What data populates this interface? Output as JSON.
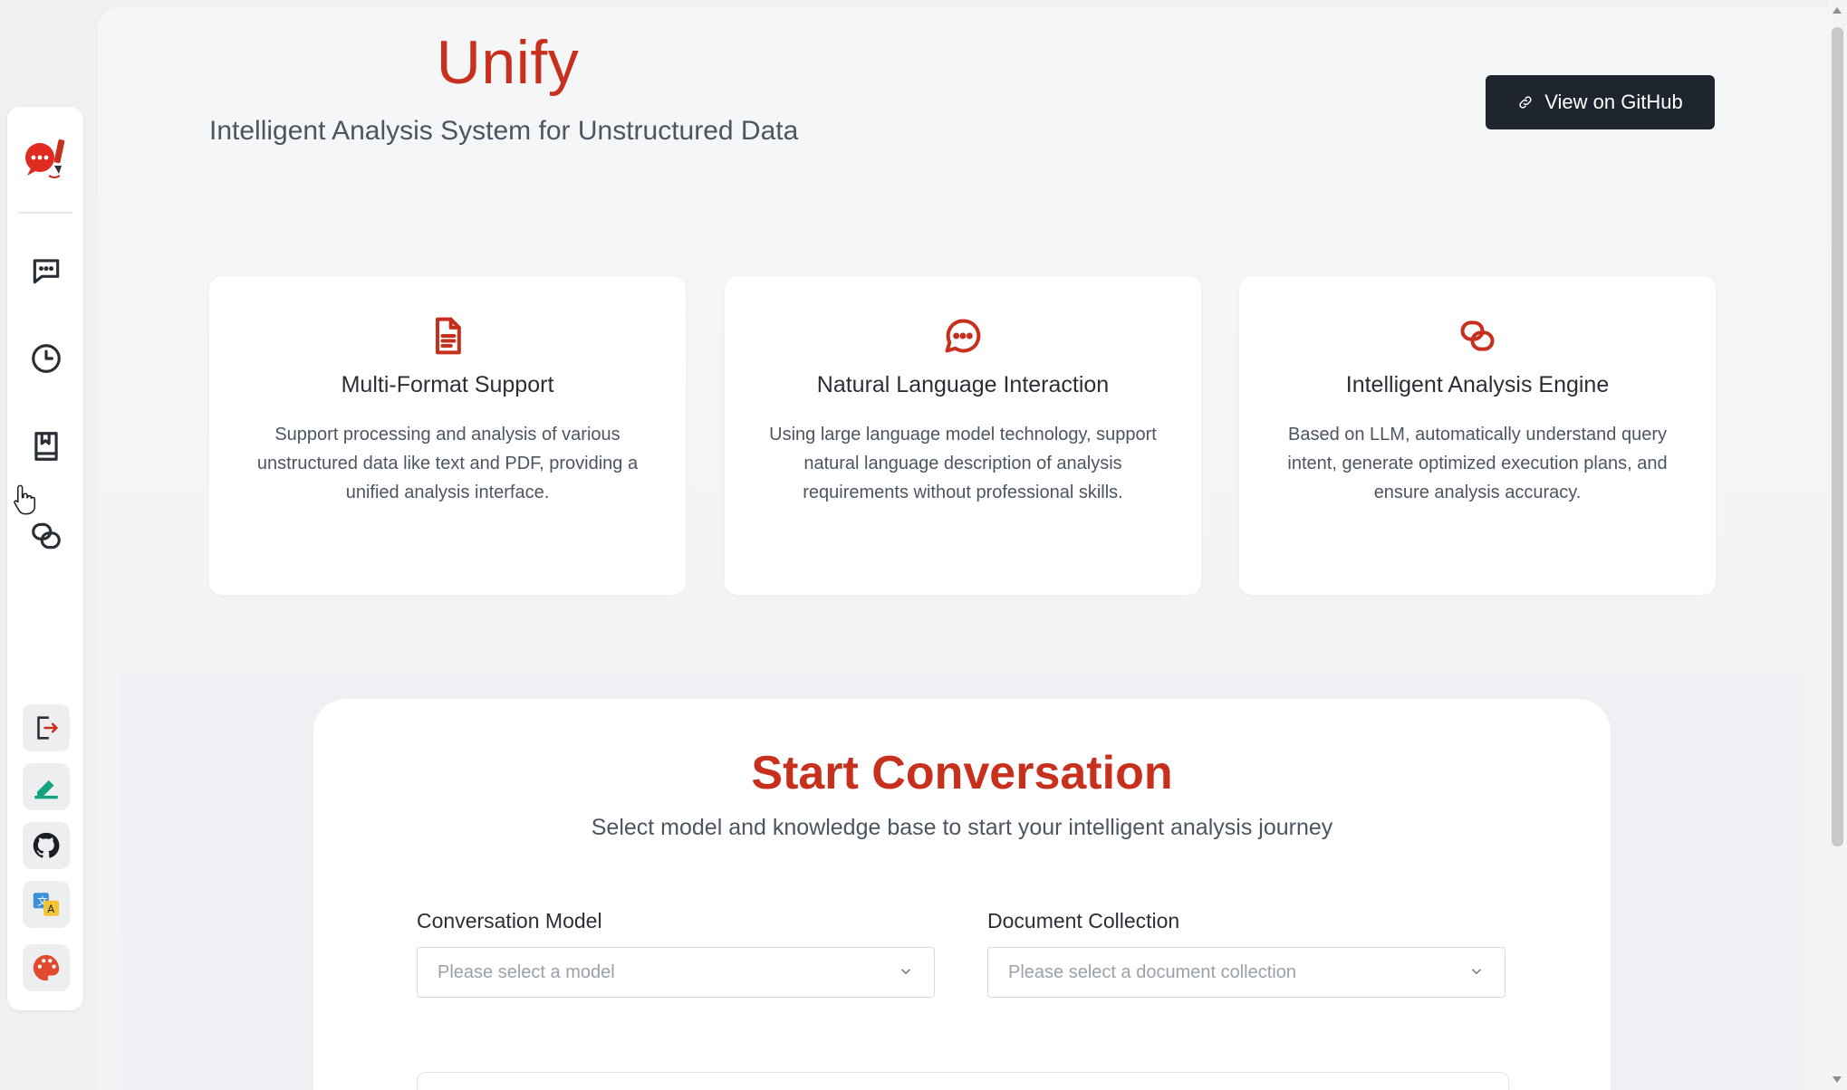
{
  "app": {
    "brand": "Unify",
    "subtitle": "Intelligent Analysis System for Unstructured Data",
    "github_button": "View on GitHub",
    "accent_color": "#c8301e"
  },
  "sidebar": {
    "logo_icon": "chat-bubble-pencil-logo",
    "nav": [
      {
        "name": "chat",
        "icon": "chat-icon"
      },
      {
        "name": "history",
        "icon": "clock-icon"
      },
      {
        "name": "knowledge-base",
        "icon": "bookmark-book-icon"
      },
      {
        "name": "collections",
        "icon": "link-chat-icon"
      }
    ],
    "tools": [
      {
        "name": "logout",
        "icon": "logout-icon"
      },
      {
        "name": "edit",
        "icon": "pen-icon"
      },
      {
        "name": "github",
        "icon": "github-icon"
      },
      {
        "name": "translate",
        "icon": "translate-icon"
      },
      {
        "name": "theme",
        "icon": "palette-icon"
      }
    ]
  },
  "features": [
    {
      "icon": "document-icon",
      "title": "Multi-Format Support",
      "description": "Support processing and analysis of various unstructured data like text and PDF, providing a unified analysis interface."
    },
    {
      "icon": "chat-bubble-icon",
      "title": "Natural Language Interaction",
      "description": "Using large language model technology, support natural language description of analysis requirements without professional skills."
    },
    {
      "icon": "engine-icon",
      "title": "Intelligent Analysis Engine",
      "description": "Based on LLM, automatically understand query intent, generate optimized execution plans, and ensure analysis accuracy."
    }
  ],
  "conversation": {
    "title": "Start Conversation",
    "lead": "Select model and knowledge base to start your intelligent analysis journey",
    "model_label": "Conversation Model",
    "model_placeholder": "Please select a model",
    "collection_label": "Document Collection",
    "collection_placeholder": "Please select a document collection"
  }
}
